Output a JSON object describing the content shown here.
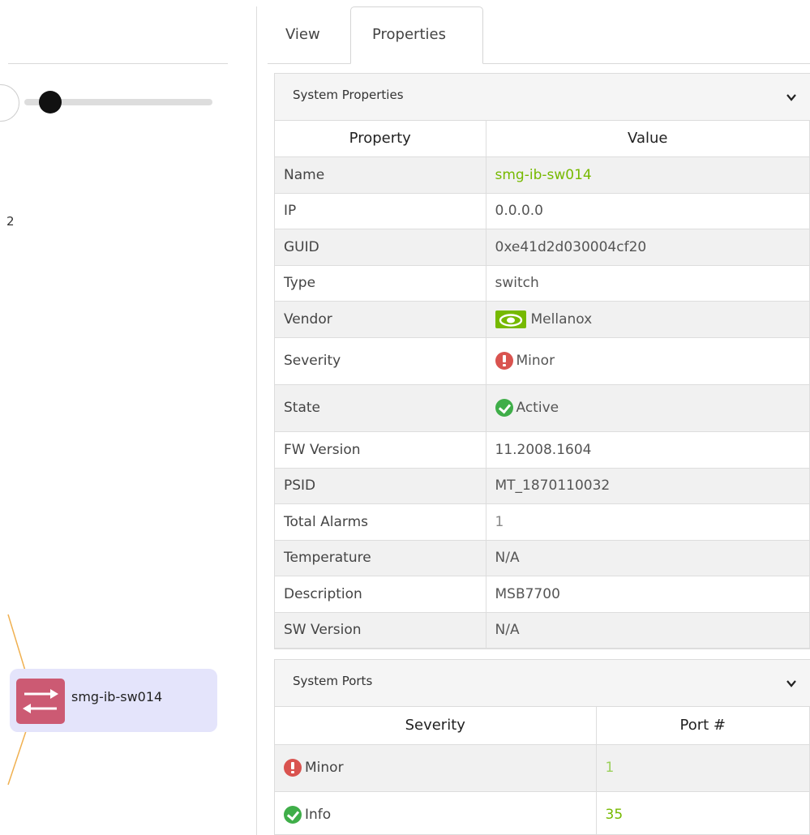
{
  "left_panel": {
    "partial_value": "2",
    "slider": {
      "level": 0.1
    },
    "node": {
      "label": "smg-ib-sw014",
      "icon": "switch-icon",
      "color": "#cc5a73",
      "bg": "#e4e4fb"
    }
  },
  "tabs": [
    {
      "label": "View",
      "active": false
    },
    {
      "label": "Properties",
      "active": true
    }
  ],
  "system_properties": {
    "title": "System Properties",
    "columns": {
      "property": "Property",
      "value": "Value"
    },
    "rows": [
      {
        "property": "Name",
        "value": "smg-ib-sw014"
      },
      {
        "property": "IP",
        "value": "0.0.0.0"
      },
      {
        "property": "GUID",
        "value": "0xe41d2d030004cf20"
      },
      {
        "property": "Type",
        "value": "switch"
      },
      {
        "property": "Vendor",
        "value": "Mellanox"
      },
      {
        "property": "Severity",
        "value": "Minor"
      },
      {
        "property": "State",
        "value": "Active"
      },
      {
        "property": "FW Version",
        "value": "11.2008.1604"
      },
      {
        "property": "PSID",
        "value": "MT_1870110032"
      },
      {
        "property": "Total Alarms",
        "value": "1"
      },
      {
        "property": "Temperature",
        "value": "N/A"
      },
      {
        "property": "Description",
        "value": "MSB7700"
      },
      {
        "property": "SW Version",
        "value": "N/A"
      }
    ]
  },
  "system_ports": {
    "title": "System Ports",
    "columns": {
      "severity": "Severity",
      "port": "Port #"
    },
    "rows": [
      {
        "severity": "Minor",
        "port": "1"
      },
      {
        "severity": "Info",
        "port": "35"
      }
    ]
  },
  "colors": {
    "link": "#76b900",
    "minor": "#d9534f",
    "ok": "#3fae49",
    "accent_line": "#f0b050"
  }
}
